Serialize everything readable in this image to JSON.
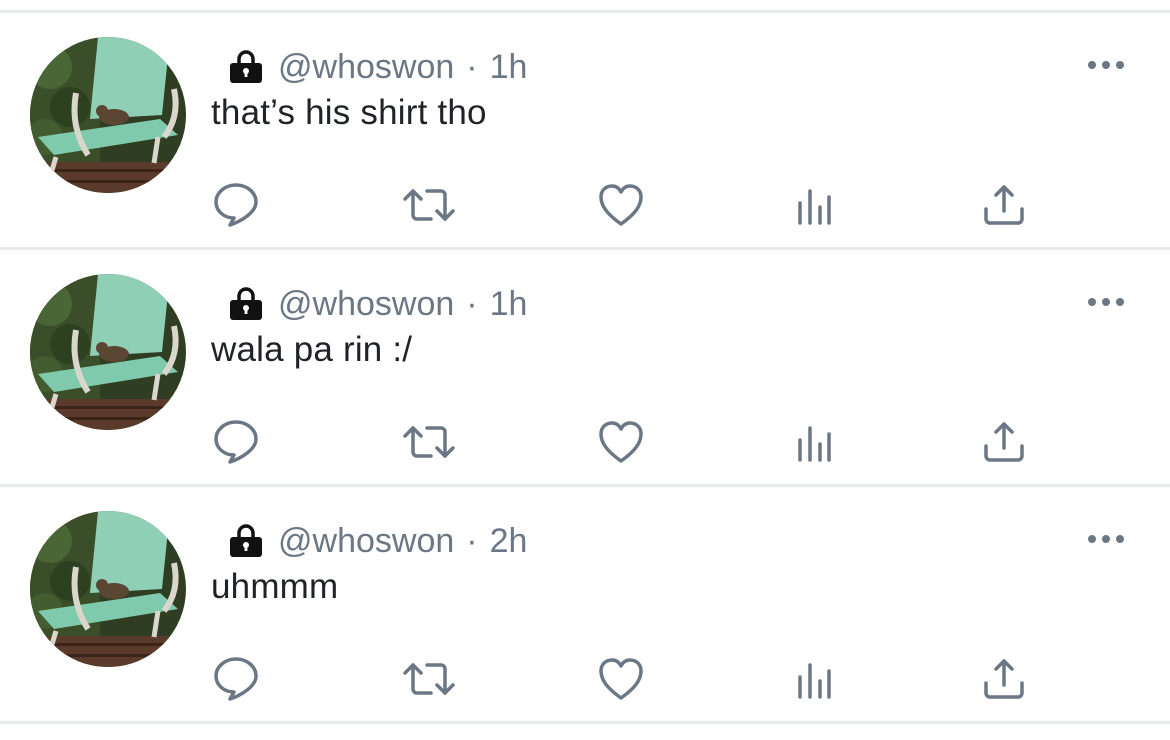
{
  "colors": {
    "meta_text": "#6b7785",
    "body_text": "#1f2328",
    "icon_stroke": "#6b7785",
    "divider": "#e8eaec",
    "lock_fill": "#111111"
  },
  "tweets": [
    {
      "handle": "@whoswon",
      "separator": "·",
      "time": "1h",
      "text": "that’s his shirt tho",
      "icons": [
        "lock-icon",
        "more-icon",
        "reply-icon",
        "retweet-icon",
        "like-icon",
        "analytics-icon",
        "share-icon"
      ]
    },
    {
      "handle": "@whoswon",
      "separator": "·",
      "time": "1h",
      "text": "wala pa rin :/",
      "icons": [
        "lock-icon",
        "more-icon",
        "reply-icon",
        "retweet-icon",
        "like-icon",
        "analytics-icon",
        "share-icon"
      ]
    },
    {
      "handle": "@whoswon",
      "separator": "·",
      "time": "2h",
      "text": "uhmmm",
      "icons": [
        "lock-icon",
        "more-icon",
        "reply-icon",
        "retweet-icon",
        "like-icon",
        "analytics-icon",
        "share-icon"
      ]
    }
  ]
}
